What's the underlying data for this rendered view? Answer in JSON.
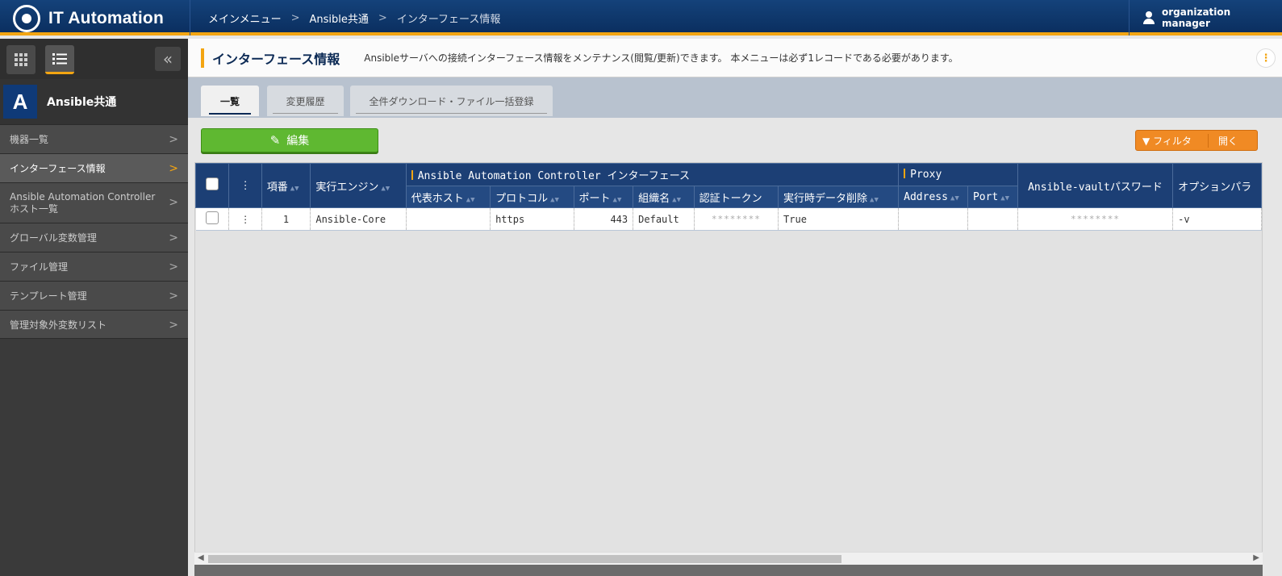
{
  "header": {
    "app_title": "IT Automation",
    "breadcrumb": [
      "メインメニュー",
      "Ansible共通",
      "インターフェース情報"
    ],
    "user": "organization manager"
  },
  "sidebar": {
    "title": "Ansible共通",
    "logo_letter": "A",
    "items": [
      {
        "label": "機器一覧"
      },
      {
        "label": "インターフェース情報",
        "active": true
      },
      {
        "label": "Ansible Automation Controller",
        "label2": "ホスト一覧"
      },
      {
        "label": "グローバル変数管理"
      },
      {
        "label": "ファイル管理"
      },
      {
        "label": "テンプレート管理"
      },
      {
        "label": "管理対象外変数リスト"
      }
    ]
  },
  "page": {
    "title": "インターフェース情報",
    "description": "Ansibleサーバへの接続インターフェース情報をメンテナンス(閲覧/更新)できます。 本メニューは必ず1レコードである必要があります。",
    "tabs": [
      "一覧",
      "変更履歴",
      "全件ダウンロード・ファイル一括登録"
    ],
    "edit_button": "編集",
    "filter_label": "フィルタ",
    "filter_open": "開く"
  },
  "table": {
    "headers": {
      "item_no": "項番",
      "engine": "実行エンジン",
      "group_aac": "Ansible Automation Controller インターフェース",
      "rep_host": "代表ホスト",
      "protocol": "プロトコル",
      "port": "ポート",
      "org": "組織名",
      "token": "認証トークン",
      "delete_data": "実行時データ削除",
      "group_proxy": "Proxy",
      "address": "Address",
      "proxy_port": "Port",
      "vault": "Ansible-vaultパスワード",
      "option": "オプションパラ"
    },
    "row": {
      "item_no": "1",
      "engine": "Ansible-Core",
      "rep_host": "",
      "protocol": "https",
      "port": "443",
      "org": "Default",
      "token": "********",
      "delete_data": "True",
      "address": "",
      "proxy_port": "",
      "vault": "********",
      "option": "-v"
    }
  },
  "colors": {
    "header_bg": "#0b2f60",
    "accent": "#f3a512",
    "edit_green": "#5fb831",
    "filter_orange": "#f08a24",
    "table_header": "#1c3f75"
  }
}
